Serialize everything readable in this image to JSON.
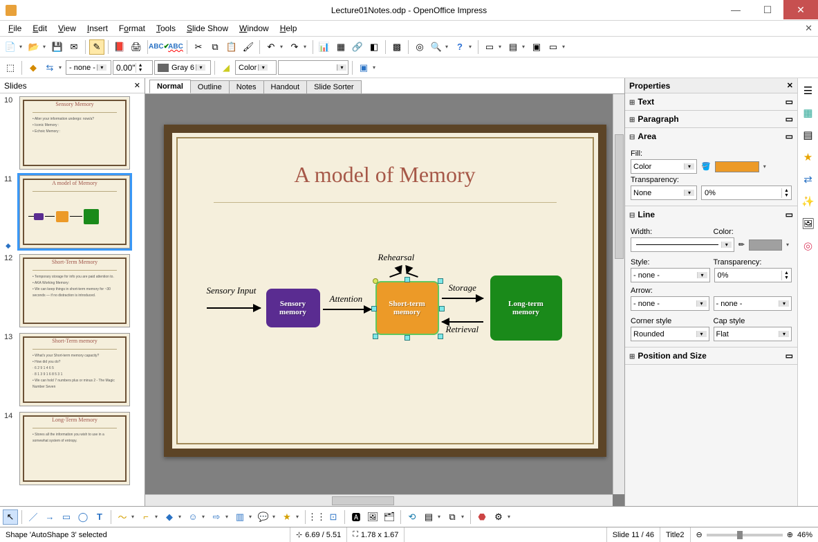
{
  "window": {
    "title": "Lecture01Notes.odp - OpenOffice Impress"
  },
  "menu": [
    "File",
    "Edit",
    "View",
    "Insert",
    "Format",
    "Tools",
    "Slide Show",
    "Window",
    "Help"
  ],
  "toolbar2": {
    "line_style": "- none -",
    "line_width": "0.00\"",
    "color_name": "Gray 6",
    "fill_type": "Color"
  },
  "slides_panel": {
    "title": "Slides",
    "thumbs": [
      {
        "n": "10",
        "title": "Sensory Memory",
        "body": "• Alter your information undergo: now/a?\n• Iconic Memory :\n• Echoic Memory :"
      },
      {
        "n": "11",
        "title": "A model of Memory",
        "body": "",
        "selected": true,
        "diagram": true
      },
      {
        "n": "12",
        "title": "Short-Term Memory",
        "body": "• Temporary storage for info you are paid attention to.\n• AKA Working Memory:\n• We can keep things in short-term memory for ~30 seconds — if no distraction is introduced."
      },
      {
        "n": "13",
        "title": "Short-Term memory",
        "body": "• What's your Short-term memory capacity?\n• How did you do?\n  · 6 2 9 1 4 6 5\n  · 8 1 3 9 1 6 8 5 3 1\n• We can hold 7 numbers plus or minus 2 - The Magic Number Seven"
      },
      {
        "n": "14",
        "title": "Long-Term Memory",
        "body": "• Stores all the information you wish to use in a somewhat system of entropy."
      }
    ]
  },
  "view_tabs": [
    "Normal",
    "Outline",
    "Notes",
    "Handout",
    "Slide Sorter"
  ],
  "slide": {
    "title": "A model of Memory",
    "boxes": {
      "sensory": "Sensory\nmemory",
      "short": "Short-term\nmemory",
      "long": "Long-term\nmemory"
    },
    "labels": {
      "sensory_input": "Sensory Input",
      "attention": "Attention",
      "rehearsal": "Rehearsal",
      "storage": "Storage",
      "retrieval": "Retrieval"
    }
  },
  "properties": {
    "title": "Properties",
    "sections": {
      "text": "Text",
      "paragraph": "Paragraph",
      "area": "Area",
      "line": "Line",
      "position": "Position and Size"
    },
    "area": {
      "fill_label": "Fill:",
      "fill_type": "Color",
      "fill_color": "#ec9a28",
      "transparency_label": "Transparency:",
      "transparency_type": "None",
      "transparency_value": "0%"
    },
    "line": {
      "width_label": "Width:",
      "color_label": "Color:",
      "color_swatch": "#a0a0a0",
      "style_label": "Style:",
      "style_value": "- none -",
      "transparency_label": "Transparency:",
      "transparency_value": "0%",
      "arrow_label": "Arrow:",
      "arrow_start": "- none -",
      "arrow_end": "- none -",
      "corner_label": "Corner style",
      "corner_value": "Rounded",
      "cap_label": "Cap style",
      "cap_value": "Flat"
    }
  },
  "status": {
    "selection": "Shape 'AutoShape 3' selected",
    "pos": "6.69 / 5.51",
    "size": "1.78 x 1.67",
    "slide": "Slide 11 / 46",
    "template": "Title2",
    "zoom": "46%"
  }
}
